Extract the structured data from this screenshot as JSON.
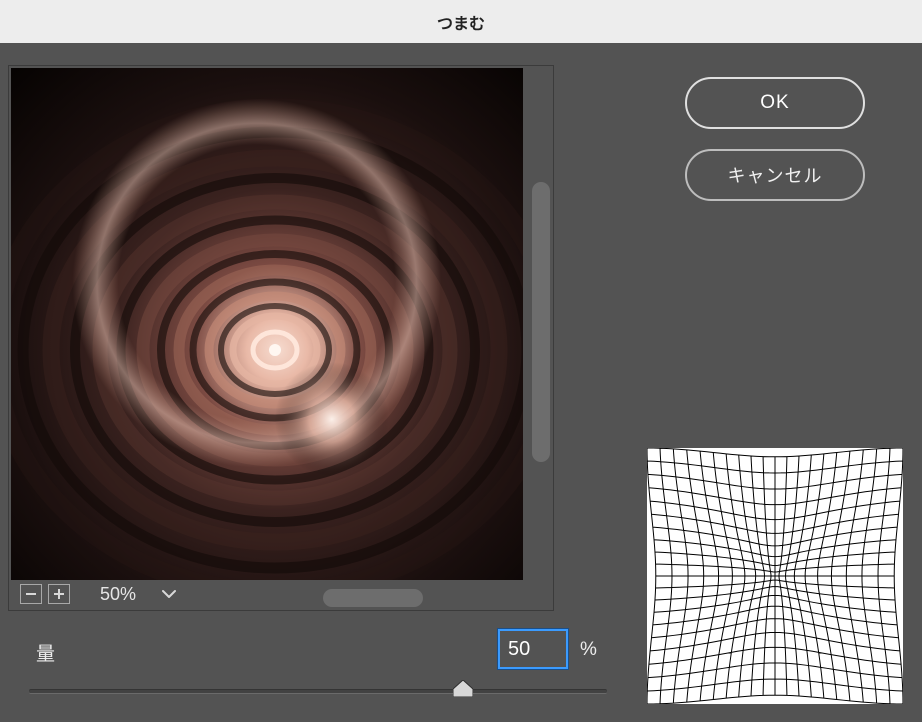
{
  "window": {
    "title": "つまむ"
  },
  "buttons": {
    "ok_label": "OK",
    "cancel_label": "キャンセル"
  },
  "zoom": {
    "value_text": "50%",
    "minus_icon": "minus-icon",
    "plus_icon": "plus-icon"
  },
  "amount": {
    "label": "量",
    "value": "50",
    "unit": "%",
    "min": -100,
    "max": 100,
    "slider_position_percent": 75
  },
  "colors": {
    "accent": "#3b9bff",
    "panel": "#535353",
    "title_bg": "#ededed",
    "scrollbar_thumb": "#6d6d6d"
  }
}
